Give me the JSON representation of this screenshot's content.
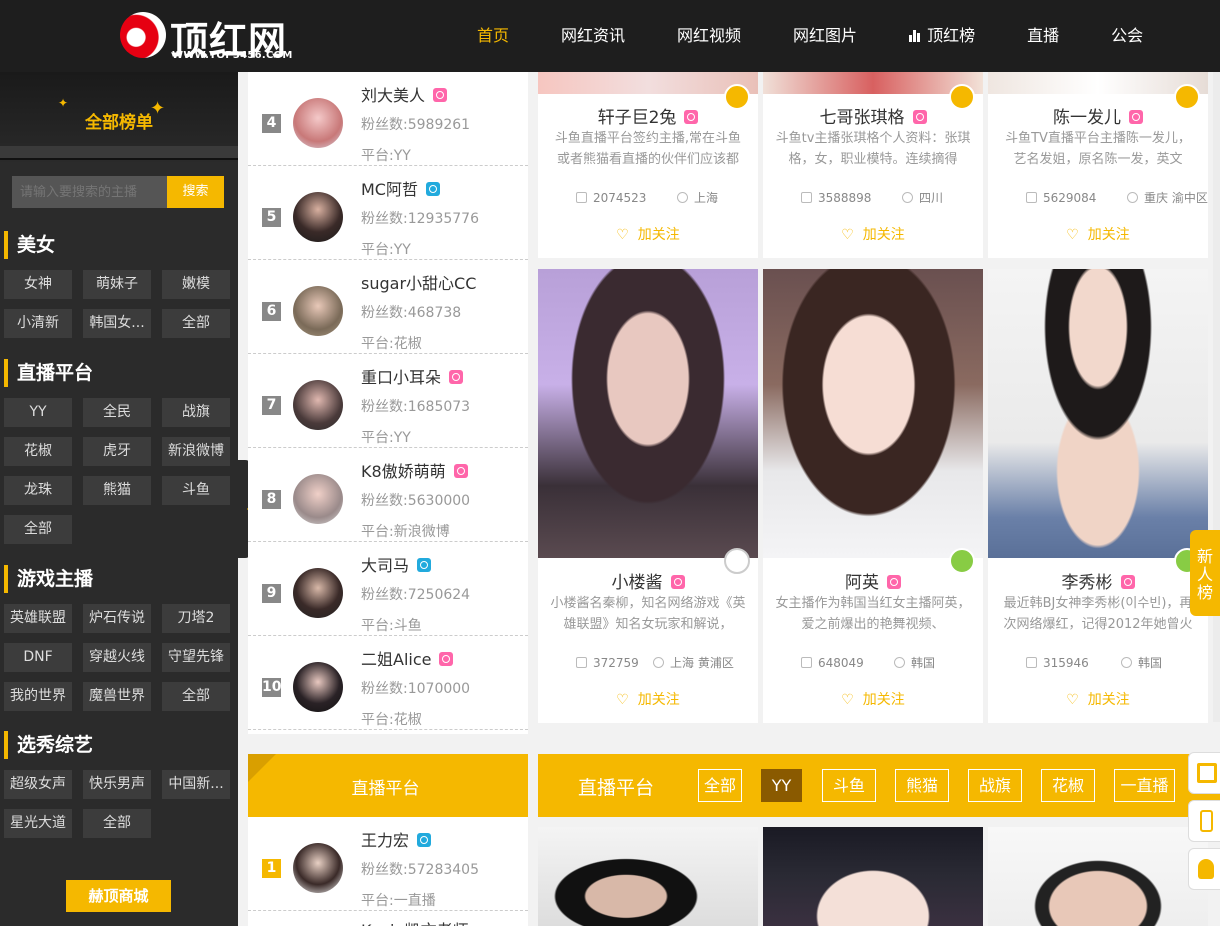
{
  "header": {
    "logo_text": "顶红网",
    "logo_url": "WWW.TOP3456.COM",
    "nav": [
      {
        "label": "首页",
        "active": true
      },
      {
        "label": "网红资讯"
      },
      {
        "label": "网红视频"
      },
      {
        "label": "网红图片"
      },
      {
        "label": "顶红榜",
        "icon": "bar-chart-icon"
      },
      {
        "label": "直播"
      },
      {
        "label": "公会"
      }
    ]
  },
  "sidebar": {
    "rank_title": "全部榜单",
    "search": {
      "placeholder": "请输入要搜索的主播",
      "button": "搜索"
    },
    "sections": [
      {
        "title": "美女",
        "tags": [
          "女神",
          "萌妹子",
          "嫩模",
          "小清新",
          "韩国女...",
          "全部"
        ]
      },
      {
        "title": "直播平台",
        "tags": [
          "YY",
          "全民",
          "战旗",
          "花椒",
          "虎牙",
          "新浪微博",
          "龙珠",
          "熊猫",
          "斗鱼",
          "全部"
        ]
      },
      {
        "title": "游戏主播",
        "tags": [
          "英雄联盟",
          "炉石传说",
          "刀塔2",
          "DNF",
          "穿越火线",
          "守望先锋",
          "我的世界",
          "魔兽世界",
          "全部"
        ]
      },
      {
        "title": "选秀综艺",
        "tags": [
          "超级女声",
          "快乐男声",
          "中国新...",
          "星光大道",
          "全部"
        ]
      }
    ],
    "mall_button": "赫顶商城"
  },
  "ranking": [
    {
      "rank": "4",
      "name": "刘大美人",
      "gender": "f",
      "fans": "粉丝数:5989261",
      "platform": "平台:YY"
    },
    {
      "rank": "5",
      "name": "MC阿哲",
      "gender": "m",
      "fans": "粉丝数:12935776",
      "platform": "平台:YY"
    },
    {
      "rank": "6",
      "name": "sugar小甜心CC",
      "gender": "",
      "fans": "粉丝数:468738",
      "platform": "平台:花椒"
    },
    {
      "rank": "7",
      "name": "重口小耳朵",
      "gender": "f",
      "fans": "粉丝数:1685073",
      "platform": "平台:YY"
    },
    {
      "rank": "8",
      "name": "K8傲娇萌萌",
      "gender": "f",
      "fans": "粉丝数:5630000",
      "platform": "平台:新浪微博"
    },
    {
      "rank": "9",
      "name": "大司马",
      "gender": "m",
      "fans": "粉丝数:7250624",
      "platform": "平台:斗鱼"
    },
    {
      "rank": "10",
      "name": "二姐Alice",
      "gender": "f",
      "fans": "粉丝数:1070000",
      "platform": "平台:花椒"
    }
  ],
  "cards_top": [
    {
      "name": "轩子巨2兔",
      "desc": "斗鱼直播平台签约主播,常在斗鱼或者熊猫看直播的伙伴们应该都",
      "fans": "2074523",
      "location": "上海",
      "follow": "加关注"
    },
    {
      "name": "七哥张琪格",
      "desc": "斗鱼tv主播张琪格个人资料：张琪格，女，职业模特。连续摘得",
      "fans": "3588898",
      "location": "四川",
      "follow": "加关注"
    },
    {
      "name": "陈一发儿",
      "desc": "斗鱼TV直播平台主播陈一发儿，艺名发姐，原名陈一发，英文",
      "fans": "5629084",
      "location": "重庆 渝中区",
      "follow": "加关注"
    }
  ],
  "cards_mid": [
    {
      "name": "小楼酱",
      "desc": "小楼酱名秦柳，知名网络游戏《英雄联盟》知名女玩家和解说，",
      "fans": "372759",
      "location": "上海 黄浦区",
      "follow": "加关注"
    },
    {
      "name": "阿英",
      "desc": "女主播作为韩国当红女主播阿英，爱之前爆出的艳舞视频、",
      "fans": "648049",
      "location": "韩国",
      "follow": "加关注"
    },
    {
      "name": "李秀彬",
      "desc": "最近韩BJ女神李秀彬(이수빈)，再次网络爆红，记得2012年她曾火",
      "fans": "315946",
      "location": "韩国",
      "follow": "加关注"
    }
  ],
  "live_section": {
    "left_title": "直播平台",
    "right_title": "直播平台",
    "tabs": [
      {
        "label": "全部"
      },
      {
        "label": "YY",
        "active": true
      },
      {
        "label": "斗鱼"
      },
      {
        "label": "熊猫"
      },
      {
        "label": "战旗"
      },
      {
        "label": "花椒"
      },
      {
        "label": "一直播"
      }
    ],
    "first_rank": {
      "rank": "1",
      "name": "王力宏",
      "gender": "m",
      "fans": "粉丝数:57283405",
      "platform": "平台:一直播"
    },
    "second_name_partial": "Kevin凯文老师"
  },
  "widgets": {
    "new_rank": "新人榜"
  },
  "colors": {
    "accent": "#f5b800",
    "header_bg": "#1e1e1e",
    "sidebar_bg": "#2b2b2b"
  }
}
